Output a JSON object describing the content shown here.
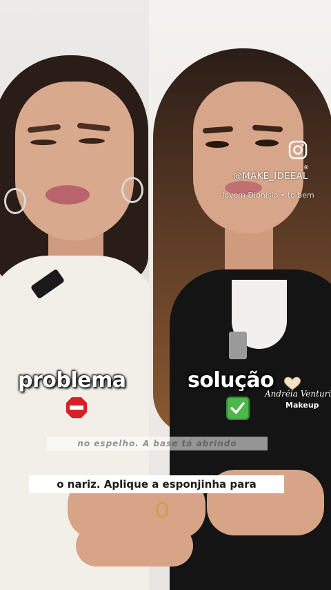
{
  "panels": {
    "left": {
      "label": "problema",
      "icon": "stop-sign-icon"
    },
    "right": {
      "label": "solução",
      "icon": "check-mark-icon"
    }
  },
  "brand": {
    "name": "Andréia Venturi",
    "subtitle": "Makeup",
    "icon": "heart-icon"
  },
  "social": {
    "icon": "instagram-icon",
    "handle": "@MAKE_IDEEAL",
    "registered_mark": "®",
    "music": "Jovem Dionísio • to bem"
  },
  "subtitles": {
    "previous": "no espelho. A base tá abrindo",
    "current": "o nariz. Aplique a esponjinha para"
  },
  "colors": {
    "stop_red": "#d62027",
    "check_green": "#4cb74a",
    "caption_bg": "#ffffff"
  }
}
